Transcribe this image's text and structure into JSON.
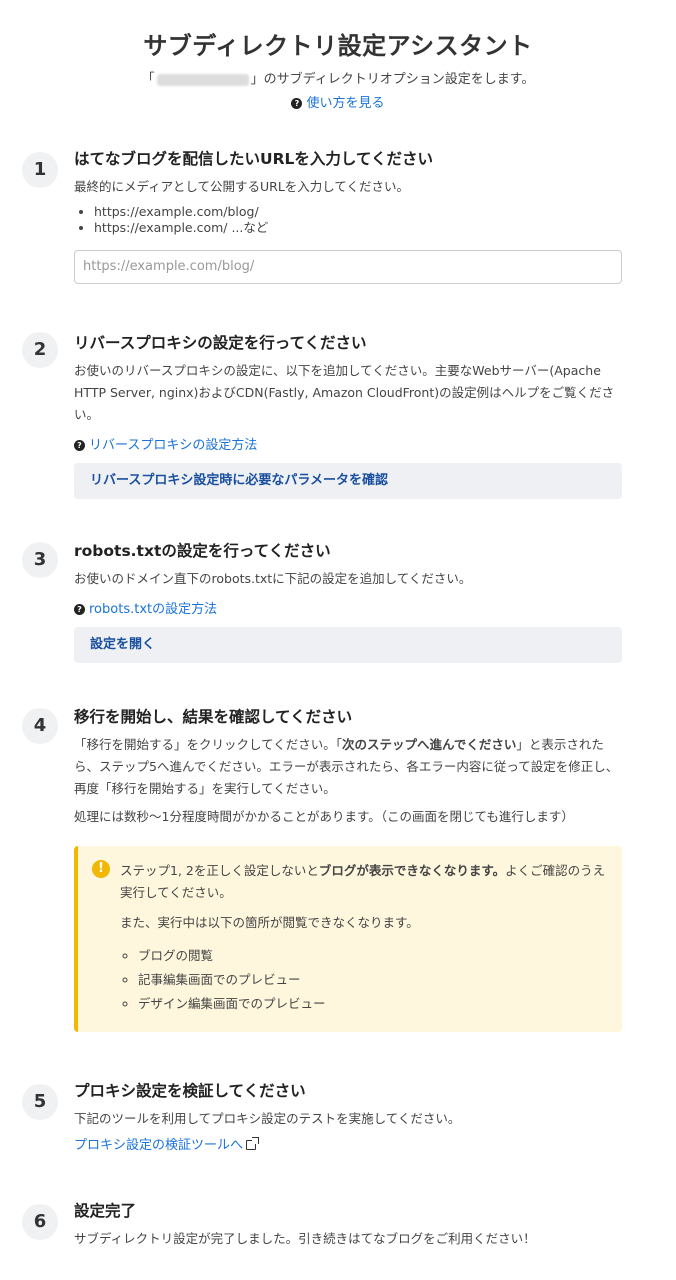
{
  "header": {
    "title": "サブディレクトリ設定アシスタント",
    "subtitle_prefix": "「",
    "subtitle_suffix": "」のサブディレクトリオプション設定をします。",
    "howto_link": "使い方を見る"
  },
  "steps": [
    {
      "number": "1",
      "heading": "はてなブログを配信したいURLを入力してください",
      "description": "最終的にメディアとして公開するURLを入力してください。",
      "examples": [
        "https://example.com/blog/",
        "https://example.com/ ...など"
      ],
      "input_placeholder": "https://example.com/blog/"
    },
    {
      "number": "2",
      "heading": "リバースプロキシの設定を行ってください",
      "description": "お使いのリバースプロキシの設定に、以下を追加してください。主要なWebサーバー(Apache HTTP Server, nginx)およびCDN(Fastly, Amazon CloudFront)の設定例はヘルプをご覧ください。",
      "help_link": "リバースプロキシの設定方法",
      "button": "リバースプロキシ設定時に必要なパラメータを確認"
    },
    {
      "number": "3",
      "heading": "robots.txtの設定を行ってください",
      "description": "お使いのドメイン直下のrobots.txtに下記の設定を追加してください。",
      "help_link": "robots.txtの設定方法",
      "button": "設定を開く"
    },
    {
      "number": "4",
      "heading": "移行を開始し、結果を確認してください",
      "desc_a": "「移行を開始する」をクリックしてください。「",
      "desc_bold": "次のステップへ進んでください",
      "desc_b": "」と表示されたら、ステップ5へ進んでください。エラーが表示されたら、各エラー内容に従って設定を修正し、再度「移行を開始する」を実行してください。",
      "note": "処理には数秒〜1分程度時間がかかることがあります。（この画面を閉じても進行します）",
      "warning": {
        "icon": "exclamation-icon",
        "text_a": "ステップ1, 2を正しく設定しないと",
        "text_bold": "ブログが表示できなくなります。",
        "text_b": "よくご確認のうえ実行してください。",
        "text2": "また、実行中は以下の箇所が閲覧できなくなります。",
        "items": [
          "ブログの閲覧",
          "記事編集画面でのプレビュー",
          "デザイン編集画面でのプレビュー"
        ]
      }
    },
    {
      "number": "5",
      "heading": "プロキシ設定を検証してください",
      "description": "下記のツールを利用してプロキシ設定のテストを実施してください。",
      "tool_link": "プロキシ設定の検証ツールへ"
    },
    {
      "number": "6",
      "heading": "設定完了",
      "description": "サブディレクトリ設定が完了しました。引き続きはてなブログをご利用ください！"
    }
  ],
  "colors": {
    "link": "#1a73d9",
    "warning_bg": "#fef7dd",
    "warning_border": "#f2b705",
    "button_bg": "#eef0f3"
  }
}
